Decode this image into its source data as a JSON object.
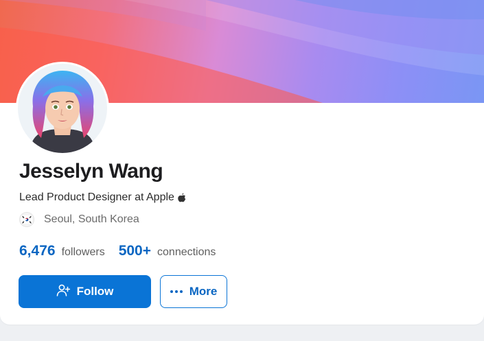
{
  "profile": {
    "name": "Jesselyn Wang",
    "headline": "Lead Product Designer at Apple",
    "location": "Seoul, South Korea"
  },
  "stats": {
    "followers_count": "6,476",
    "followers_label": "followers",
    "connections_count": "500+",
    "connections_label": "connections"
  },
  "actions": {
    "follow_label": "Follow",
    "more_label": "More"
  },
  "icons": {
    "headline_icon": "apple-logo-icon",
    "location_icon": "south-korea-flag-icon",
    "follow_icon": "add-person-icon",
    "more_icon": "ellipsis-icon"
  },
  "colors": {
    "accent": "#0a66c2",
    "button_fill": "#0a74d6",
    "name_text": "#1d1d1f"
  }
}
